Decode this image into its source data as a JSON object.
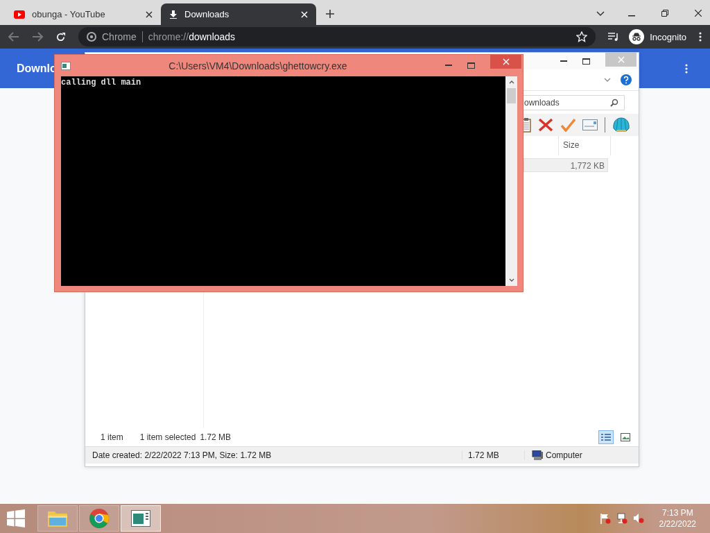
{
  "browser": {
    "tabs": [
      {
        "title": "obunga - YouTube",
        "selected": false
      },
      {
        "title": "Downloads",
        "selected": true
      }
    ],
    "omnibox": {
      "chip": "Chrome",
      "scheme": "chrome://",
      "host": "downloads"
    },
    "profile": "Incognito",
    "page": {
      "title": "Downlo"
    }
  },
  "explorer": {
    "search": {
      "value": "ownloads"
    },
    "columns": [
      "Size"
    ],
    "rows": [
      {
        "size": "1,772 KB",
        "selected": true
      }
    ],
    "status": {
      "count": "1 item",
      "selection": "1 item selected",
      "selection_size": "1.72 MB"
    },
    "views": [
      {
        "kind": "details",
        "selected": true
      },
      {
        "kind": "thumbnails",
        "selected": false
      }
    ],
    "details": {
      "text": "Date created: 2/22/2022 7:13 PM, Size: 1.72 MB",
      "size": "1.72 MB",
      "zone": "Computer"
    }
  },
  "console": {
    "title": "C:\\Users\\VM4\\Downloads\\ghettowcry.exe",
    "lines": [
      "calling dll main"
    ]
  },
  "taskbar": {
    "apps": [
      {
        "kind": "explorer",
        "selected": false
      },
      {
        "kind": "chrome",
        "selected": false
      },
      {
        "kind": "console",
        "selected": true
      }
    ],
    "time": "7:13 PM",
    "date": "2/22/2022"
  }
}
